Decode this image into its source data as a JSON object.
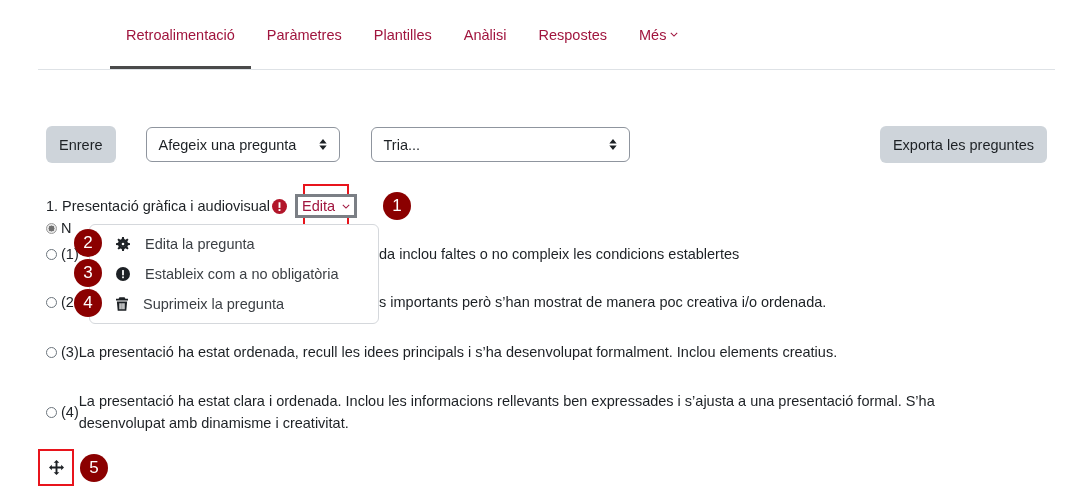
{
  "tabs": [
    {
      "label": "Retroalimentació",
      "selected": true,
      "caret": false
    },
    {
      "label": "Paràmetres",
      "selected": false,
      "caret": false
    },
    {
      "label": "Plantilles",
      "selected": false,
      "caret": false
    },
    {
      "label": "Anàlisi",
      "selected": false,
      "caret": false
    },
    {
      "label": "Respostes",
      "selected": false,
      "caret": false
    },
    {
      "label": "Més",
      "selected": false,
      "caret": true
    }
  ],
  "toolbar": {
    "back_button": "Enrere",
    "add_question_select": "Afegeix una pregunta",
    "choose_select": "Tria...",
    "export_button": "Exporta les preguntes"
  },
  "question": {
    "title": "1. Presentació gràfica i audiovisual",
    "required": true,
    "edit_button": "Edita",
    "edit_callout": "1",
    "menu": [
      {
        "kind": "gear",
        "label": "Edita la pregunta",
        "callout": "2"
      },
      {
        "kind": "required",
        "label": "Estableix com a no obligatòria",
        "callout": "3"
      },
      {
        "kind": "trash",
        "label": "Suprimeix la pregunta",
        "callout": "4"
      }
    ],
    "options": [
      {
        "label": "N",
        "selected": true
      },
      {
        "kind": "covered",
        "label": "(1)",
        "text": "da inclou faltes o no compleix les condicions establertes",
        "selected": false
      },
      {
        "kind": "covered",
        "label": "(2",
        "text": "s importants però s’han mostrat de manera poc creativa i/o ordenada.",
        "selected": false
      },
      {
        "kind": "full",
        "label": "(3)",
        "text": "La presentació ha estat ordenada, recull les idees principals i s’ha desenvolupat formalment. Inclou elements creatius.",
        "selected": false
      },
      {
        "kind": "full",
        "label": "(4)",
        "text": "La presentació ha estat clara i ordenada. Inclou les informacions rellevants ben expressades i s’ajusta a una presentació formal. S’ha desenvolupat amb dinamisme i creativitat.",
        "selected": false
      }
    ],
    "move_callout": "5"
  }
}
